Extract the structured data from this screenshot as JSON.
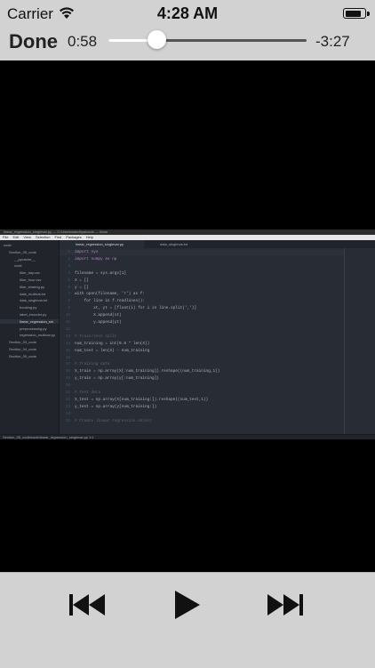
{
  "status_bar": {
    "carrier": "Carrier",
    "time": "4:28 AM",
    "battery_level": 0.9,
    "icons": [
      "wifi-icon",
      "battery-icon"
    ]
  },
  "player": {
    "done_label": "Done",
    "elapsed": "0:58",
    "remaining": "-3:27",
    "progress": 0.24,
    "controls": [
      "rewind-icon",
      "play-icon",
      "fast-forward-icon"
    ]
  },
  "editor": {
    "window_title": "linear_regression_singlevar.py — C:\\Users\\sandhya\\code — Atom",
    "menu": [
      "File",
      "Edit",
      "View",
      "Selection",
      "Find",
      "Packages",
      "Help"
    ],
    "tabs": [
      "linear_regression_singlevar.py",
      "data_singlevar.txt"
    ],
    "tree": [
      {
        "label": "code",
        "depth": 0,
        "selected": false
      },
      {
        "label": "Section_05_code",
        "depth": 1,
        "selected": false
      },
      {
        "label": "__pycache__",
        "depth": 2,
        "selected": false
      },
      {
        "label": "code",
        "depth": 2,
        "selected": false
      },
      {
        "label": "bike_day.csv",
        "depth": 3,
        "selected": false
      },
      {
        "label": "bike_hour.csv",
        "depth": 3,
        "selected": false
      },
      {
        "label": "bike_sharing.py",
        "depth": 3,
        "selected": false
      },
      {
        "label": "data_multivar.txt",
        "depth": 3,
        "selected": false
      },
      {
        "label": "data_singlevar.txt",
        "depth": 3,
        "selected": false
      },
      {
        "label": "housing.py",
        "depth": 3,
        "selected": false
      },
      {
        "label": "label_encoder.py",
        "depth": 3,
        "selected": false
      },
      {
        "label": "linear_regression_sin",
        "depth": 3,
        "selected": true
      },
      {
        "label": "preprocessing.py",
        "depth": 3,
        "selected": false
      },
      {
        "label": "regression_multivar.py",
        "depth": 3,
        "selected": false
      },
      {
        "label": "Section_03_code",
        "depth": 1,
        "selected": false
      },
      {
        "label": "Section_04_code",
        "depth": 1,
        "selected": false
      },
      {
        "label": "Section_05_code",
        "depth": 1,
        "selected": false
      }
    ],
    "code_lines": [
      {
        "n": "1",
        "text": "import sys",
        "style": "kw"
      },
      {
        "n": "2",
        "text": "import numpy as np",
        "style": "kw"
      },
      {
        "n": "3",
        "text": "",
        "style": ""
      },
      {
        "n": "4",
        "text": "filename = sys.argv[1]",
        "style": ""
      },
      {
        "n": "5",
        "text": "X = []",
        "style": ""
      },
      {
        "n": "6",
        "text": "y = []",
        "style": ""
      },
      {
        "n": "7",
        "text": "with open(filename, 'r') as f:",
        "style": ""
      },
      {
        "n": "8",
        "text": "    for line in f.readlines():",
        "style": ""
      },
      {
        "n": "9",
        "text": "        xt, yt = [float(i) for i in line.split(',')]",
        "style": ""
      },
      {
        "n": "10",
        "text": "        X.append(xt)",
        "style": ""
      },
      {
        "n": "11",
        "text": "        y.append(yt)",
        "style": ""
      },
      {
        "n": "12",
        "text": "",
        "style": ""
      },
      {
        "n": "13",
        "text": "# Train/test split",
        "style": "cmt"
      },
      {
        "n": "14",
        "text": "num_training = int(0.8 * len(X))",
        "style": ""
      },
      {
        "n": "15",
        "text": "num_test = len(X) - num_training",
        "style": ""
      },
      {
        "n": "16",
        "text": "",
        "style": ""
      },
      {
        "n": "17",
        "text": "# Training data",
        "style": "cmt"
      },
      {
        "n": "18",
        "text": "X_train = np.array(X[:num_training]).reshape((num_training,1))",
        "style": ""
      },
      {
        "n": "19",
        "text": "y_train = np.array(y[:num_training])",
        "style": ""
      },
      {
        "n": "20",
        "text": "",
        "style": ""
      },
      {
        "n": "21",
        "text": "# Test data",
        "style": "cmt"
      },
      {
        "n": "22",
        "text": "X_test = np.array(X[num_training:]).reshape((num_test,1))",
        "style": ""
      },
      {
        "n": "23",
        "text": "y_test = np.array(y[num_training:])",
        "style": ""
      },
      {
        "n": "24",
        "text": "",
        "style": ""
      },
      {
        "n": "25",
        "text": "# Create linear regression object",
        "style": "cmt"
      }
    ],
    "status": "Section_05_code\\code\\linear_regression_singlevar.py   1:1"
  }
}
